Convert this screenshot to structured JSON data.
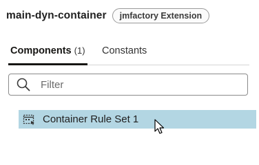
{
  "header": {
    "title": "main-dyn-container",
    "badge": "jmfactory Extension"
  },
  "tabs": [
    {
      "label": "Components",
      "count": "(1)",
      "active": true
    },
    {
      "label": "Constants",
      "active": false
    }
  ],
  "filter": {
    "placeholder": "Filter",
    "value": "",
    "icon": "search-icon"
  },
  "list": {
    "items": [
      {
        "label": "Container Rule Set 1",
        "icon": "rule-set-icon",
        "selected": true
      }
    ]
  },
  "colors": {
    "selected_row": "#b3d6e3",
    "active_tab_underline": "#161513",
    "badge_border": "#9a9a9a"
  }
}
